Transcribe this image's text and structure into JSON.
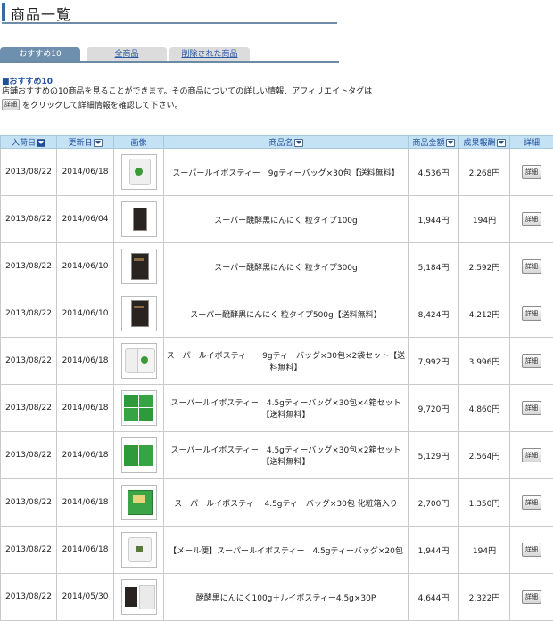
{
  "page_title": "商品一覧",
  "tabs": [
    {
      "label": "おすすめ10",
      "active": true
    },
    {
      "label": "全商品",
      "active": false
    },
    {
      "label": "削除された商品",
      "active": false
    }
  ],
  "section": {
    "heading": "■おすすめ10",
    "desc_line1": "店舗おすすめの10商品を見ることができます。その商品についての詳しい情報、アフィリエイトタグは",
    "desc_button": "詳細",
    "desc_line2": "をクリックして詳細情報を確認して下さい。"
  },
  "columns": {
    "arrival": "入荷日",
    "updated": "更新日",
    "image": "画像",
    "name": "商品名",
    "price": "商品金額",
    "reward": "成果報酬",
    "detail": "詳細"
  },
  "detail_label": "詳細",
  "rows": [
    {
      "arrival": "2013/08/22",
      "updated": "2014/06/18",
      "name": "スーパールイボスティー　9gティーバッグ×30包【送料無料】",
      "price": "4,536円",
      "reward": "2,268円",
      "img": "white"
    },
    {
      "arrival": "2013/08/22",
      "updated": "2014/06/04",
      "name": "スーパー醗酵黒にんにく 粒タイプ100g",
      "price": "1,944円",
      "reward": "194円",
      "img": "dark-small"
    },
    {
      "arrival": "2013/08/22",
      "updated": "2014/06/10",
      "name": "スーパー醗酵黒にんにく 粒タイプ300g",
      "price": "5,184円",
      "reward": "2,592円",
      "img": "dark"
    },
    {
      "arrival": "2013/08/22",
      "updated": "2014/06/10",
      "name": "スーパー醗酵黒にんにく 粒タイプ500g【送料無料】",
      "price": "8,424円",
      "reward": "4,212円",
      "img": "dark"
    },
    {
      "arrival": "2013/08/22",
      "updated": "2014/06/18",
      "name": "スーパールイボスティー　9gティーバッグ×30包×2袋セット【送料無料】",
      "price": "7,992円",
      "reward": "3,996円",
      "img": "white2"
    },
    {
      "arrival": "2013/08/22",
      "updated": "2014/06/18",
      "name": "スーパールイボスティー　4.5gティーバッグ×30包×4箱セット【送料無料】",
      "price": "9,720円",
      "reward": "4,860円",
      "img": "green4"
    },
    {
      "arrival": "2013/08/22",
      "updated": "2014/06/18",
      "name": "スーパールイボスティー　4.5gティーバッグ×30包×2箱セット【送料無料】",
      "price": "5,129円",
      "reward": "2,564円",
      "img": "green2"
    },
    {
      "arrival": "2013/08/22",
      "updated": "2014/06/18",
      "name": "スーパールイボスティー 4.5gティーバッグ×30包 化粧箱入り",
      "price": "2,700円",
      "reward": "1,350円",
      "img": "green1"
    },
    {
      "arrival": "2013/08/22",
      "updated": "2014/06/18",
      "name": "【メール便】スーパールイボスティー　4.5gティーバッグ×20包",
      "price": "1,944円",
      "reward": "194円",
      "img": "white-small"
    },
    {
      "arrival": "2013/08/22",
      "updated": "2014/05/30",
      "name": "醗酵黒にんにく100g＋ルイボスティー4.5g×30P",
      "price": "4,644円",
      "reward": "2,322円",
      "img": "combo"
    }
  ],
  "colors": {
    "accent": "#1e4f9c",
    "header_bg": "#c5e1f4",
    "tab_active": "#6f8fae"
  }
}
